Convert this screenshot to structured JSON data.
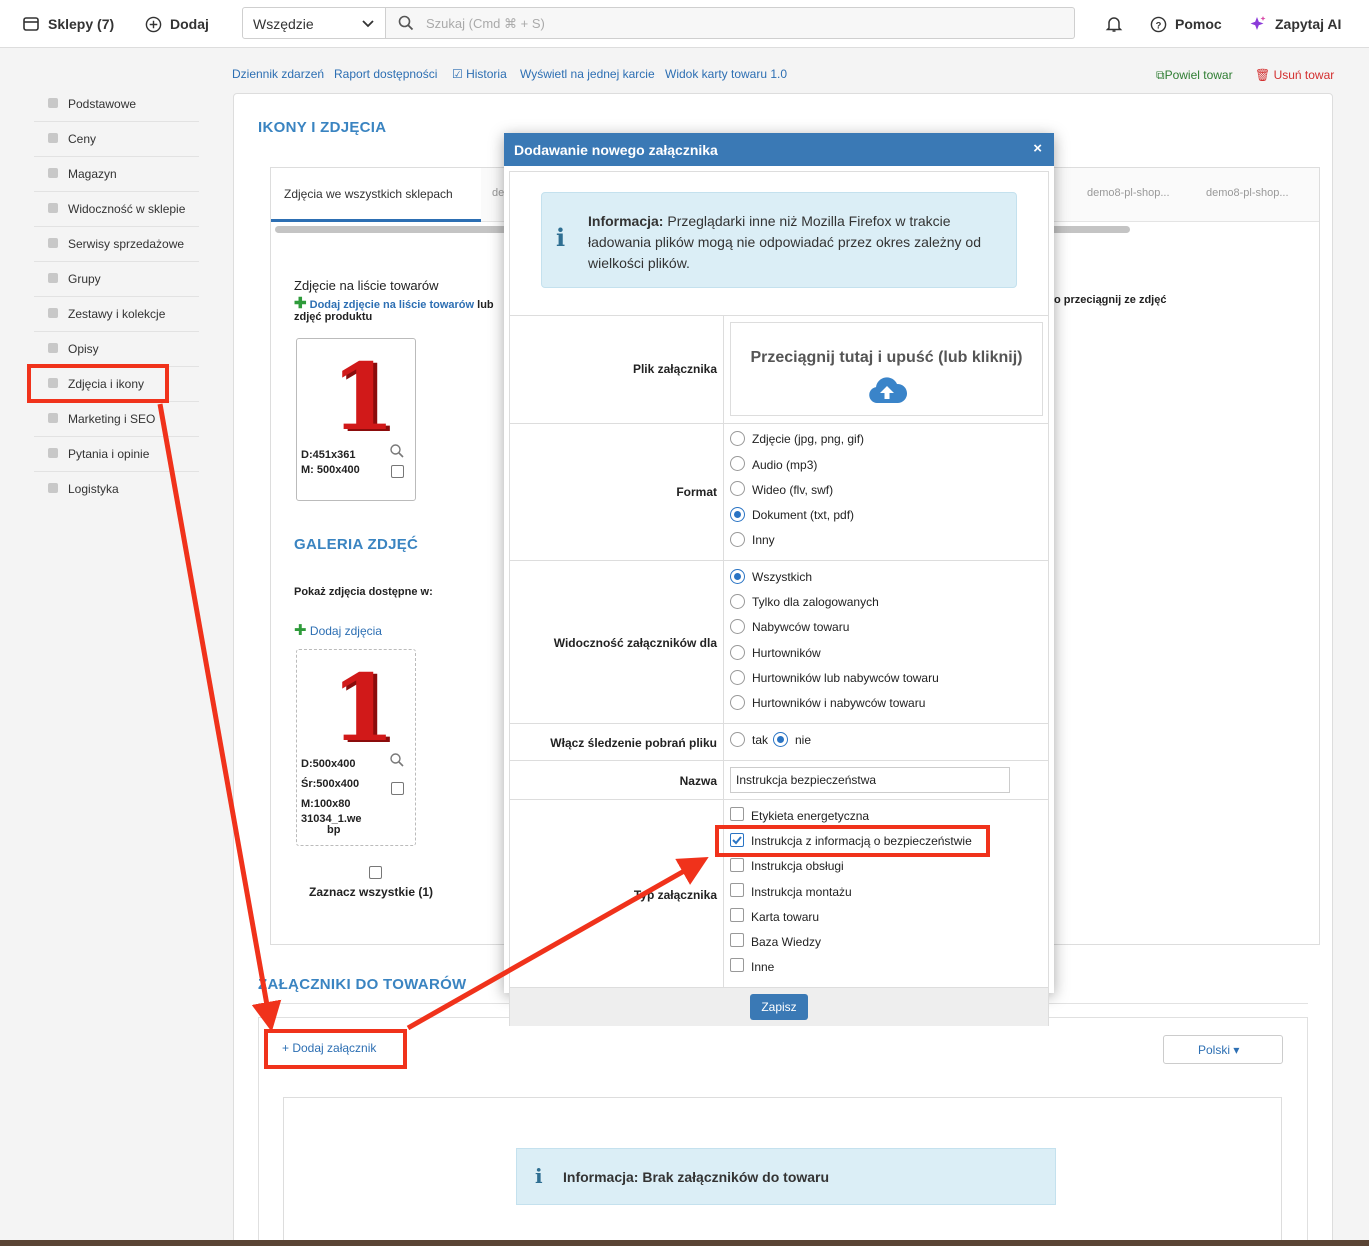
{
  "topbar": {
    "shops_label": "Sklepy (7)",
    "add_label": "Dodaj",
    "scope_value": "Wszędzie",
    "search_placeholder": "Szukaj (Cmd ⌘ + S)",
    "help_label": "Pomoc",
    "ai_label": "Zapytaj AI"
  },
  "sidebar": {
    "items": [
      {
        "label": "Podstawowe"
      },
      {
        "label": "Ceny"
      },
      {
        "label": "Magazyn"
      },
      {
        "label": "Widoczność w sklepie"
      },
      {
        "label": "Serwisy sprzedażowe"
      },
      {
        "label": "Grupy"
      },
      {
        "label": "Zestawy i kolekcje"
      },
      {
        "label": "Opisy"
      },
      {
        "label": "Zdjęcia i ikony"
      },
      {
        "label": "Marketing i SEO"
      },
      {
        "label": "Pytania i opinie"
      },
      {
        "label": "Logistyka"
      }
    ]
  },
  "links": {
    "journal": "Dziennik zdarzeń",
    "availability": "Raport dostępności",
    "history": "Historia",
    "one_card": "Wyświetl na jednej karcie",
    "card_view": "Widok karty towaru 1.0",
    "duplicate": "Powiel towar",
    "delete": "Usuń towar"
  },
  "main": {
    "section_title": "IKONY I ZDJĘCIA",
    "tabs": [
      {
        "label": "Zdjęcia we wszystkich sklepach"
      },
      {
        "label": "de"
      },
      {
        "label": "demo8-pl-shop..."
      },
      {
        "label": "demo8-pl-shop..."
      }
    ],
    "list_photo_title": "Zdjęcie na liście towarów",
    "add_photo_link": "Dodaj zdjęcie",
    "add_photo_suffix": "na liście towarów",
    "add_photo_tail": "lub",
    "drag_text_right": "o przeciągnij ze zdjęć",
    "product_photos_text": "zdjęć produktu",
    "thumb1": {
      "glyph": "1",
      "d": "D:451x361",
      "m": "M: 500x400"
    },
    "gallery_title": "GALERIA ZDJĘĆ",
    "show_available": "Pokaż zdjęcia dostępne w:",
    "gallery_add": "Dodaj zdjęcia",
    "thumb2": {
      "glyph": "1",
      "d": "D:500x400",
      "s": "Śr:500x400",
      "m": "M:100x80",
      "file": "31034_1.we",
      "file2": "bp"
    },
    "select_all": "Zaznacz wszystkie (1)",
    "attachments_title": "ZAŁĄCZNIKI DO TOWARÓW",
    "add_attachment": "+ Dodaj załącznik",
    "language": "Polski",
    "no_attachments": "Informacja: Brak załączników do towaru"
  },
  "modal": {
    "title": "Dodawanie nowego załącznika",
    "close": "×",
    "info_bold": "Informacja:",
    "info_text": "Przeglądarki inne niż Mozilla Firefox w trakcie ładowania plików mogą nie odpowiadać przez okres zależny od wielkości plików.",
    "file_label": "Plik załącznika",
    "dropzone": "Przeciągnij tutaj i upuść (lub kliknij)",
    "format_label": "Format",
    "formats": [
      {
        "label": "Zdjęcie (jpg, png, gif)",
        "selected": false
      },
      {
        "label": "Audio (mp3)",
        "selected": false
      },
      {
        "label": "Wideo (flv, swf)",
        "selected": false
      },
      {
        "label": "Dokument (txt, pdf)",
        "selected": true
      },
      {
        "label": "Inny",
        "selected": false
      }
    ],
    "visibility_label": "Widoczność załączników dla",
    "visibility": [
      {
        "label": "Wszystkich",
        "selected": true
      },
      {
        "label": "Tylko dla zalogowanych",
        "selected": false
      },
      {
        "label": "Nabywców towaru",
        "selected": false
      },
      {
        "label": "Hurtowników",
        "selected": false
      },
      {
        "label": "Hurtowników lub nabywców towaru",
        "selected": false
      },
      {
        "label": "Hurtowników i nabywców towaru",
        "selected": false
      }
    ],
    "tracking_label": "Włącz śledzenie pobrań pliku",
    "tracking_yes": "tak",
    "tracking_no": "nie",
    "name_label": "Nazwa",
    "name_value": "Instrukcja bezpieczeństwa",
    "type_label": "Typ załącznika",
    "types": [
      {
        "label": "Etykieta energetyczna",
        "checked": false
      },
      {
        "label": "Instrukcja z informacją o bezpieczeństwie",
        "checked": true
      },
      {
        "label": "Instrukcja obsługi",
        "checked": false
      },
      {
        "label": "Instrukcja montażu",
        "checked": false
      },
      {
        "label": "Karta towaru",
        "checked": false
      },
      {
        "label": "Baza Wiedzy",
        "checked": false
      },
      {
        "label": "Inne",
        "checked": false
      }
    ],
    "save": "Zapisz"
  },
  "colors": {
    "accent": "#3a79b5",
    "annotation": "#f0321b",
    "info_bg": "#dbeef6"
  }
}
